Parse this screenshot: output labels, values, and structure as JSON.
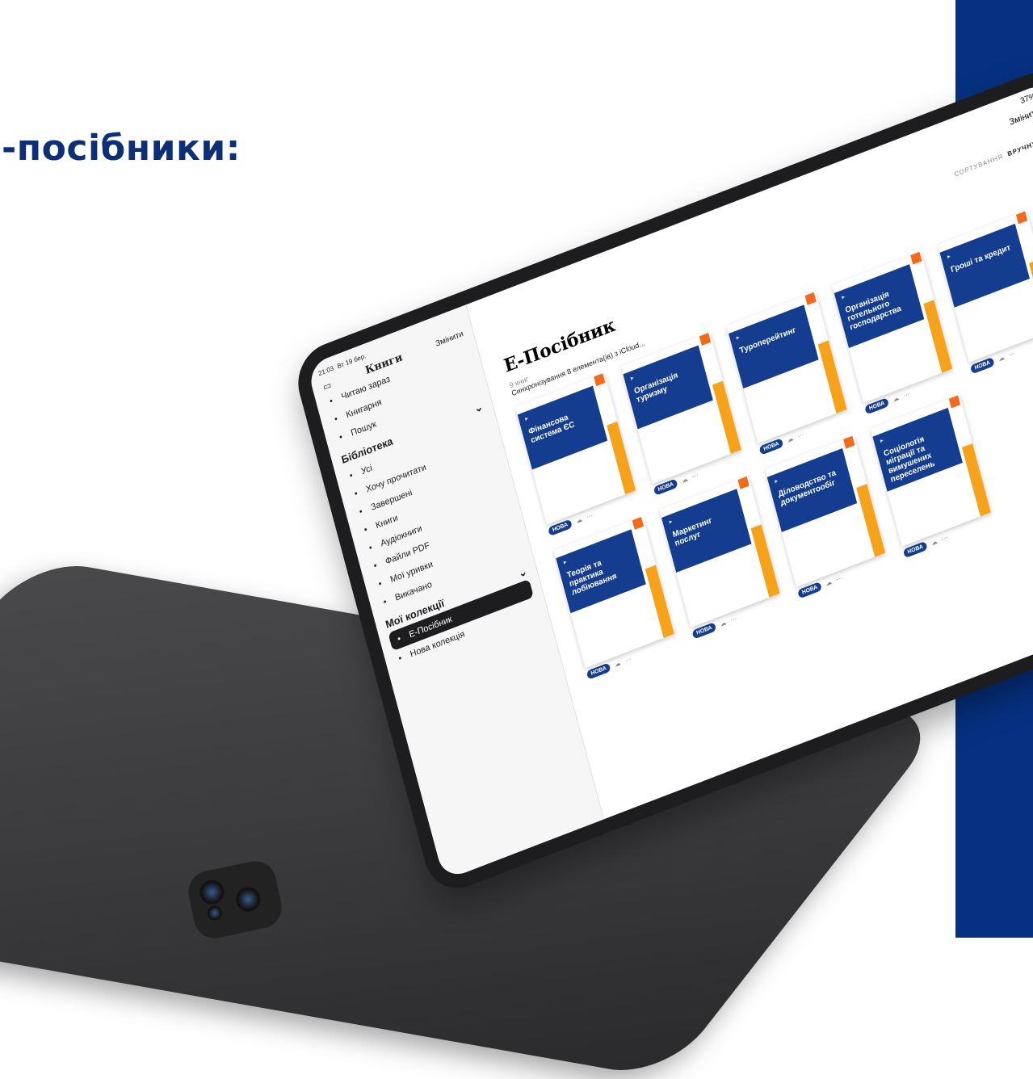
{
  "heading": "-посібники:",
  "tablet": {
    "status": {
      "time": "21:03",
      "date": "Вт 19 бер.",
      "battery": "37%"
    },
    "sidebar": {
      "title": "Книги",
      "edit_label": "Змінити",
      "nav": [
        {
          "label": "Читаю зараз",
          "icon": "book-open-icon"
        },
        {
          "label": "Книгарня",
          "icon": "bag-icon"
        },
        {
          "label": "Пошук",
          "icon": "search-icon"
        }
      ],
      "library_title": "Бібліотека",
      "library": [
        {
          "label": "Усі",
          "icon": "books-icon"
        },
        {
          "label": "Хочу прочитати",
          "icon": "arrow-circle-icon"
        },
        {
          "label": "Завершені",
          "icon": "check-circle-icon"
        },
        {
          "label": "Книги",
          "icon": "book-open-icon"
        },
        {
          "label": "Аудіокниги",
          "icon": "headphones-icon"
        },
        {
          "label": "Файли PDF",
          "icon": "document-icon"
        },
        {
          "label": "Мої уривки",
          "icon": "note-icon"
        },
        {
          "label": "Викачано",
          "icon": "cloud-download-icon"
        }
      ],
      "collections_title": "Мої колекції",
      "collections": [
        {
          "label": "Е-Посібник",
          "icon": "list-icon",
          "active": true
        },
        {
          "label": "Нова колекція",
          "icon": "plus-icon",
          "active": false
        }
      ]
    },
    "main": {
      "edit_label": "Змінити",
      "sort_label": "СОРТУВАННЯ",
      "sort_value": "ВРУЧНУ",
      "title": "Е-Посібник",
      "count": "9 книг",
      "sync": "Синхронізування 8 елемента(ів) з iCloud...",
      "badge": "НОВА",
      "books": [
        "Фінансова система ЄС",
        "Організація туризму",
        "Туроперейтинг",
        "Організація готельного господарства",
        "Гроші та кредит",
        "Теорія та практика лобіювання",
        "Маркетинг послуг",
        "Діловодство та документообіг",
        "Соціологія міграції та вимушених переселень"
      ]
    }
  }
}
